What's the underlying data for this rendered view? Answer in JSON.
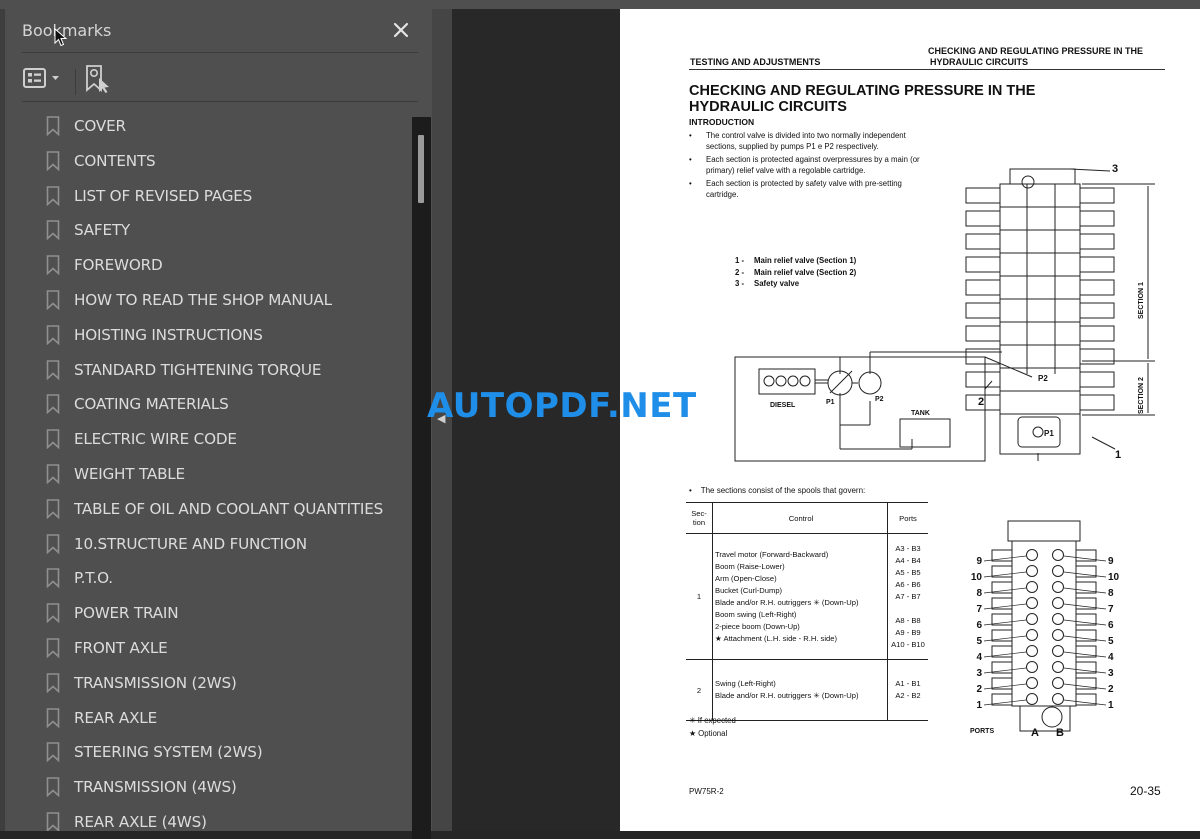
{
  "sidebar": {
    "title": "Bookmarks",
    "close_icon": "close-icon",
    "options_icon": "bookmark-options-icon",
    "find_icon": "find-current-bookmark-icon",
    "items": [
      {
        "label": "COVER"
      },
      {
        "label": "CONTENTS"
      },
      {
        "label": "LIST OF REVISED PAGES"
      },
      {
        "label": "SAFETY"
      },
      {
        "label": "FOREWORD"
      },
      {
        "label": "HOW TO READ THE SHOP MANUAL"
      },
      {
        "label": "HOISTING INSTRUCTIONS"
      },
      {
        "label": "STANDARD TIGHTENING TORQUE"
      },
      {
        "label": "COATING MATERIALS"
      },
      {
        "label": "ELECTRIC WIRE CODE"
      },
      {
        "label": "WEIGHT TABLE"
      },
      {
        "label": "TABLE OF OIL AND COOLANT QUANTITIES"
      },
      {
        "label": "10.STRUCTURE AND FUNCTION"
      },
      {
        "label": "P.T.O."
      },
      {
        "label": "POWER TRAIN"
      },
      {
        "label": "FRONT AXLE"
      },
      {
        "label": "TRANSMISSION (2WS)"
      },
      {
        "label": "REAR AXLE"
      },
      {
        "label": "STEERING SYSTEM (2WS)"
      },
      {
        "label": "TRANSMISSION (4WS)"
      },
      {
        "label": "REAR AXLE (4WS)"
      }
    ]
  },
  "watermark": "AUTOPDF.NET",
  "page": {
    "header_left": "TESTING AND ADJUSTMENTS",
    "header_right_1": "CHECKING AND REGULATING PRESSURE IN THE",
    "header_right_2": "HYDRAULIC CIRCUITS",
    "title_1": "CHECKING AND REGULATING PRESSURE IN THE",
    "title_2": "HYDRAULIC CIRCUITS",
    "intro_heading": "INTRODUCTION",
    "bullets": [
      "The control valve is divided into two normally independent sections, supplied by pumps P1 e P2 respectively.",
      "Each section is protected against overpressures by a main (or primary) relief valve with a regolable cartridge.",
      "Each section is protected by safety valve with pre-setting cartridge."
    ],
    "legend": [
      {
        "num": "1 -",
        "text": "Main relief valve (Section 1)"
      },
      {
        "num": "2 -",
        "text": "Main relief valve (Section 2)"
      },
      {
        "num": "3 -",
        "text": "Safety valve"
      }
    ],
    "diagram1": {
      "diesel": "DIESEL",
      "p1": "P1",
      "p2": "P2",
      "tank": "TANK",
      "section1": "SECTION 1",
      "section2": "SECTION 2",
      "callout1": "1",
      "callout2": "2",
      "callout3": "3"
    },
    "sections_intro": "The sections consist of the spools that govern:",
    "table": {
      "headers": {
        "section": "Sec-tion",
        "control": "Control",
        "ports": "Ports"
      },
      "rows": [
        {
          "section": "1",
          "controls": [
            "Travel motor (Forward-Backward)",
            "Boom (Raise-Lower)",
            "Arm (Open-Close)",
            "Bucket (Curl-Dump)",
            "Blade and/or R.H. outriggers ✳ (Down-Up)",
            "Boom swing (Left-Right)",
            "2-piece boom (Down-Up)",
            "★ Attachment (L.H. side - R.H. side)"
          ],
          "ports": [
            "A3 - B3",
            "A4 - B4",
            "A5 - B5",
            "A6 - B6",
            "A7 - B7",
            "A8 - B8",
            "A9 - B9",
            "A10 - B10"
          ]
        },
        {
          "section": "2",
          "controls": [
            "Swing (Left-Right)",
            "Blade and/or R.H. outriggers ✳ (Down-Up)"
          ],
          "ports": [
            "A1 - B1",
            "A2 - B2"
          ]
        }
      ]
    },
    "footnotes": [
      "✳ If expected",
      "★ Optional"
    ],
    "diagram2": {
      "ports_label": "PORTS",
      "a": "A",
      "b": "B",
      "numbers": [
        "9",
        "10",
        "8",
        "7",
        "6",
        "5",
        "4",
        "3",
        "2",
        "1"
      ]
    },
    "footer_left": "PW75R-2",
    "footer_right": "20-35"
  }
}
